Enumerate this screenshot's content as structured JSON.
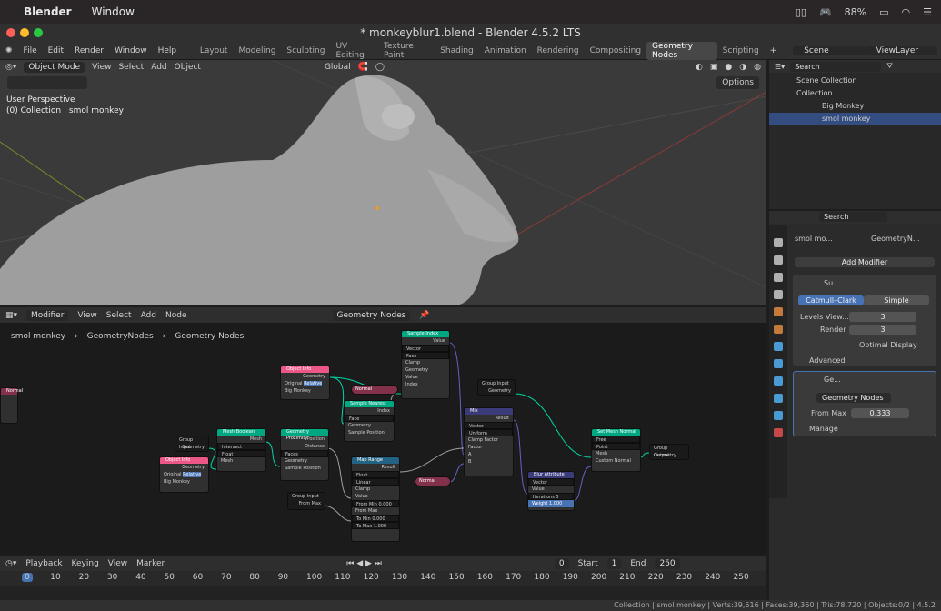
{
  "macbar": {
    "apple": "",
    "app": "Blender",
    "menu": "Window",
    "battery": "88%",
    "wifi": "wifi-icon"
  },
  "window": {
    "title": "* monkeyblur1.blend - Blender 4.5.2 LTS"
  },
  "topbar": {
    "file": "File",
    "edit": "Edit",
    "render": "Render",
    "window": "Window",
    "help": "Help",
    "workspaces": [
      "Layout",
      "Modeling",
      "Sculpting",
      "UV Editing",
      "Texture Paint",
      "Shading",
      "Animation",
      "Rendering",
      "Compositing",
      "Geometry Nodes",
      "Scripting"
    ],
    "active_workspace": "Geometry Nodes",
    "scene": "Scene",
    "viewlayer": "ViewLayer"
  },
  "viewport": {
    "mode": "Object Mode",
    "menus": [
      "View",
      "Select",
      "Add",
      "Object"
    ],
    "orientation": "Global",
    "perspective": "User Perspective",
    "collection_info": "(0) Collection | smol monkey",
    "options": "Options"
  },
  "node_editor": {
    "type": "Modifier",
    "menus": [
      "View",
      "Select",
      "Add",
      "Node"
    ],
    "tree": "Geometry Nodes",
    "breadcrumb": [
      "smol monkey",
      "GeometryNodes",
      "Geometry Nodes"
    ],
    "nodes": {
      "object_info_1": {
        "title": "Object Info",
        "geometry": "Geometry",
        "original": "Original",
        "relative": "Relative",
        "object": "Big Monkey"
      },
      "object_info_2": {
        "title": "Object Info",
        "geometry": "Geometry",
        "original": "Original",
        "relative": "Relative",
        "object": "Big Monkey"
      },
      "group_input_1": {
        "title": "Group Input",
        "geometry": "Geometry"
      },
      "group_input_2": {
        "title": "Group Input",
        "geometry": "Geometry"
      },
      "group_input_3": {
        "title": "Group Input",
        "from_max": "From Max"
      },
      "mesh_boolean": {
        "title": "Mesh Boolean",
        "mesh": "Mesh",
        "op": "Intersect",
        "solver": "Float",
        "mesh_in": "Mesh"
      },
      "geometry_proximity": {
        "title": "Geometry Proximity",
        "position": "Position",
        "distance": "Distance",
        "mode": "Faces",
        "geometry": "Geometry",
        "sample_position": "Sample Position"
      },
      "sample_index": {
        "title": "Sample Index",
        "value": "Value",
        "type": "Vector",
        "domain": "Face",
        "clamp": "Clamp",
        "geometry": "Geometry",
        "value_in": "Value",
        "index": "Index"
      },
      "sample_nearest": {
        "title": "Sample Nearest",
        "index": "Index",
        "domain": "Face",
        "geometry": "Geometry",
        "sample_position": "Sample Position"
      },
      "normal_1": {
        "title": "Normal"
      },
      "normal_2": {
        "title": "Normal"
      },
      "map_range": {
        "title": "Map Range",
        "result": "Result",
        "type": "Float",
        "interp": "Linear",
        "clamp": "Clamp",
        "value": "Value",
        "from_min": "From Min",
        "from_min_v": "0.000",
        "from_max": "From Max",
        "to_min": "To Min",
        "to_min_v": "0.000",
        "to_max": "To Max",
        "to_max_v": "1.000"
      },
      "mix": {
        "title": "Mix",
        "result": "Result",
        "type": "Vector",
        "mode": "Uniform",
        "clamp": "Clamp Factor",
        "factor": "Factor",
        "a": "A",
        "b": "B"
      },
      "blur_attribute": {
        "title": "Blur Attribute",
        "value": "Value",
        "type": "Vector",
        "value_in": "Value",
        "iterations": "Iterations",
        "iterations_v": "5",
        "weight": "Weight",
        "weight_v": "1.000"
      },
      "set_mesh_normal": {
        "title": "Set Mesh Normal",
        "mode": "Free",
        "domain": "Point",
        "mesh": "Mesh",
        "custom_normal": "Custom Normal"
      },
      "group_output": {
        "title": "Group Output",
        "geometry": "Geometry"
      },
      "left_partial": {
        "title": "Normal"
      }
    }
  },
  "timeline": {
    "playback": "Playback",
    "keying": "Keying",
    "view": "View",
    "marker": "Marker",
    "current_frame": "0",
    "start_label": "Start",
    "start": "1",
    "end_label": "End",
    "end": "250",
    "ticks": [
      "0",
      "10",
      "20",
      "30",
      "40",
      "50",
      "60",
      "70",
      "80",
      "90",
      "100",
      "110",
      "120",
      "130",
      "140",
      "150",
      "160",
      "170",
      "180",
      "190",
      "200",
      "210",
      "220",
      "230",
      "240",
      "250"
    ]
  },
  "status": {
    "text": "Collection | smol monkey | Verts:39,616 | Faces:39,360 | Tris:78,720 | Objects:0/2 | 4.5.2"
  },
  "outliner": {
    "search_placeholder": "Search",
    "scene_collection": "Scene Collection",
    "collection": "Collection",
    "items": [
      "Big Monkey",
      "smol monkey"
    ]
  },
  "properties": {
    "search_placeholder": "Search",
    "object": "smol mo...",
    "modifier_path": "GeometryN...",
    "add_modifier": "Add Modifier",
    "subsurf": {
      "name": "Su...",
      "catmull": "Catmull–Clark",
      "simple": "Simple",
      "levels_label": "Levels View...",
      "levels": "3",
      "render_label": "Render",
      "render": "3",
      "optimal": "Optimal Display",
      "advanced": "Advanced"
    },
    "geonodes": {
      "name": "Ge...",
      "tree": "Geometry Nodes",
      "from_max_label": "From Max",
      "from_max": "0.333",
      "manage": "Manage"
    }
  },
  "colors": {
    "accent": "#4772b3",
    "geo_link": "#00d6a3",
    "vector_link": "#6363c7",
    "float_link": "#a1a1a1",
    "object_header": "#ed5788",
    "geo_header": "#00d6a3",
    "util_header": "#246283",
    "input_header": "#83314a",
    "field_header": "#4c9797"
  }
}
